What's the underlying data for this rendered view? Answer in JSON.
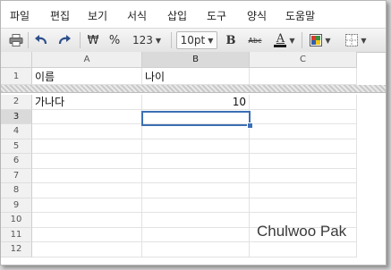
{
  "menu": [
    "파일",
    "편집",
    "보기",
    "서식",
    "삽입",
    "도구",
    "양식",
    "도움말"
  ],
  "toolbar": {
    "currency_symbol": "₩",
    "percent_symbol": "%",
    "number_format_label": "123",
    "font_size": "10pt",
    "bold_label": "B",
    "strikethrough_label": "Abc",
    "text_color_label": "A",
    "text_color": "#1a1a1a",
    "fill_color": "#d83b2b",
    "icons": [
      "print-icon",
      "undo-icon",
      "redo-icon",
      "bold-icon",
      "strikethrough-icon",
      "text-color-icon",
      "fill-color-icon",
      "borders-icon"
    ]
  },
  "grid": {
    "columns": [
      "A",
      "B",
      "C"
    ],
    "selected_column": "B",
    "frozen_row": {
      "number": "1",
      "a": "이름",
      "b": "나이"
    },
    "rows": [
      {
        "number": "2",
        "a": "가나다",
        "b": "10"
      },
      {
        "number": "3",
        "a": "",
        "b": ""
      },
      {
        "number": "4",
        "a": "",
        "b": ""
      },
      {
        "number": "5",
        "a": "",
        "b": ""
      },
      {
        "number": "6",
        "a": "",
        "b": ""
      },
      {
        "number": "7",
        "a": "",
        "b": ""
      },
      {
        "number": "8",
        "a": "",
        "b": ""
      },
      {
        "number": "9",
        "a": "",
        "b": ""
      },
      {
        "number": "10",
        "a": "",
        "b": ""
      },
      {
        "number": "11",
        "a": "",
        "b": ""
      },
      {
        "number": "12",
        "a": "",
        "b": ""
      }
    ],
    "selected_cell": "B3",
    "selection_color": "#3c6fb5"
  },
  "watermark": "Chulwoo Pak"
}
